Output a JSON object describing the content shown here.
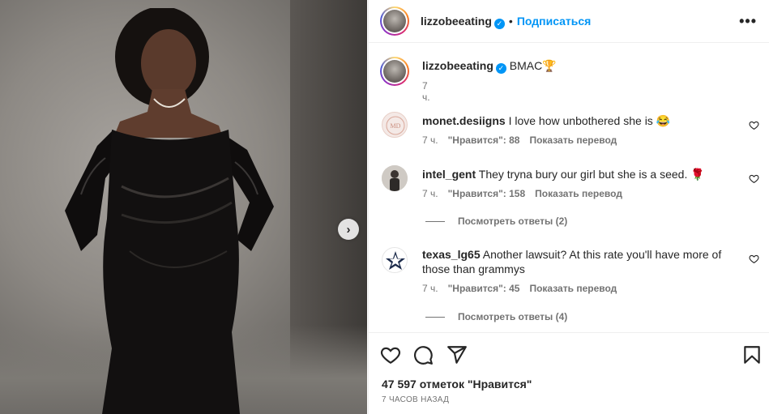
{
  "post": {
    "author": "lizzobeeating",
    "follow_label": "Подписаться",
    "dot": "•",
    "more_glyph": "•••",
    "next_glyph": "›"
  },
  "caption": {
    "author": "lizzobeeating",
    "text": "BMAC🏆",
    "time": "7 ч."
  },
  "comments": [
    {
      "author": "monet.desiigns",
      "text": "I love how unbothered she is 😂",
      "time": "7 ч.",
      "likes": "\"Нравится\": 88",
      "translate": "Показать перевод",
      "replies": ""
    },
    {
      "author": "intel_gent",
      "text": "They tryna bury our girl but she is a seed. 🌹",
      "time": "7 ч.",
      "likes": "\"Нравится\": 158",
      "translate": "Показать перевод",
      "replies": "Посмотреть ответы (2)"
    },
    {
      "author": "texas_lg65",
      "text": "Another lawsuit? At this rate you'll have more of those than grammys",
      "time": "7 ч.",
      "likes": "\"Нравится\": 45",
      "translate": "Показать перевод",
      "replies": "Посмотреть ответы (4)"
    }
  ],
  "footer": {
    "likes": "47 597 отметок \"Нравится\"",
    "ago": "7 ЧАСОВ НАЗАД"
  },
  "icons": {
    "verified": "verified-badge-icon",
    "like": "heart-icon",
    "comment": "comment-bubble-icon",
    "share": "paper-plane-icon",
    "save": "bookmark-icon"
  },
  "colors": {
    "accent": "#0095f6",
    "text": "#262626",
    "muted": "#737373",
    "divider": "#efefef"
  }
}
